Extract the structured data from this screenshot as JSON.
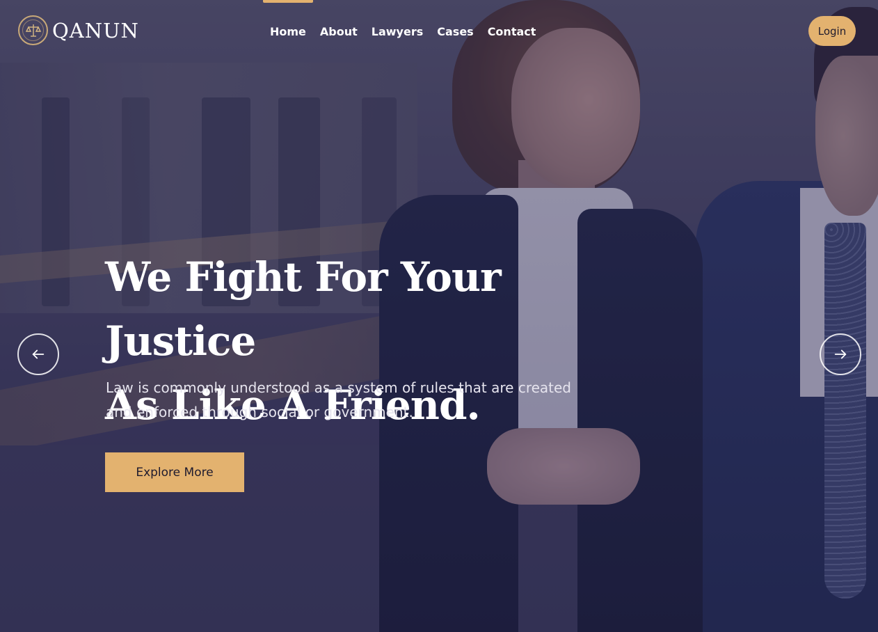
{
  "brand": {
    "name": "QANUN",
    "logo_icon": "scales-of-justice-icon"
  },
  "nav": {
    "items": [
      {
        "label": "Home",
        "active": true
      },
      {
        "label": "About",
        "active": false
      },
      {
        "label": "Lawyers",
        "active": false
      },
      {
        "label": "Cases",
        "active": false
      },
      {
        "label": "Contact",
        "active": false
      }
    ]
  },
  "header": {
    "login_label": "Login"
  },
  "hero": {
    "headline_line1": "We Fight For Your Justice",
    "headline_line2": "As Like A Friend.",
    "subtext_line1": "Law is commonly understood as a system of rules that are created",
    "subtext_line2": "and enforced through social or government.",
    "cta_label": "Explore More",
    "prev_icon": "arrow-left-icon",
    "next_icon": "arrow-right-icon"
  },
  "colors": {
    "accent": "#e3b26f",
    "overlay": "#28264e",
    "text": "#ffffff",
    "button_text": "#1f1b2e"
  }
}
